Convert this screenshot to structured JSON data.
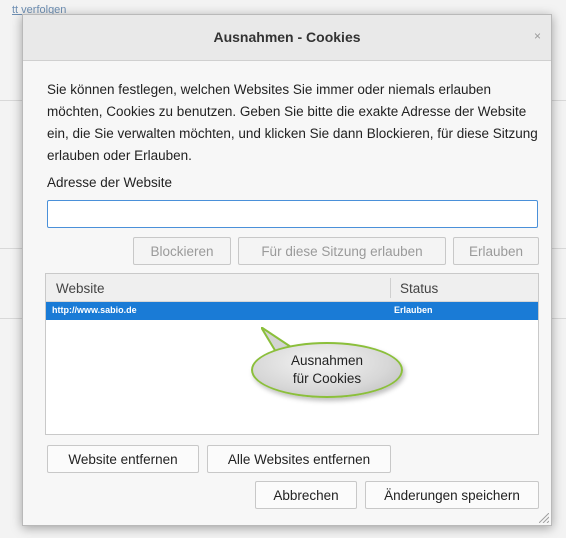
{
  "background": {
    "fragment": "tt verfolgen"
  },
  "dialog": {
    "title": "Ausnahmen - Cookies",
    "close_glyph": "×",
    "description": "Sie können festlegen, welchen Websites Sie immer oder niemals erlauben möchten, Cookies zu benutzen. Geben Sie bitte die exakte Adresse der Website ein, die Sie verwalten möchten, und klicken Sie dann Blockieren, für diese Sitzung erlauben oder Erlauben.",
    "address_label": "Adresse der Website",
    "address_value": "",
    "buttons": {
      "block": "Blockieren",
      "allow_session": "Für diese Sitzung erlauben",
      "allow": "Erlauben",
      "remove_site": "Website entfernen",
      "remove_all": "Alle Websites entfernen",
      "cancel": "Abbrechen",
      "save": "Änderungen speichern"
    },
    "table": {
      "columns": [
        "Website",
        "Status"
      ],
      "rows": [
        {
          "website": "http://www.sabio.de",
          "status": "Erlauben",
          "selected": true
        }
      ]
    },
    "callout": {
      "line1": "Ausnahmen",
      "line2": "für Cookies"
    }
  },
  "colors": {
    "selection": "#1a7bd6",
    "callout_border": "#8bbf3b",
    "input_focus": "#4a90d9"
  }
}
